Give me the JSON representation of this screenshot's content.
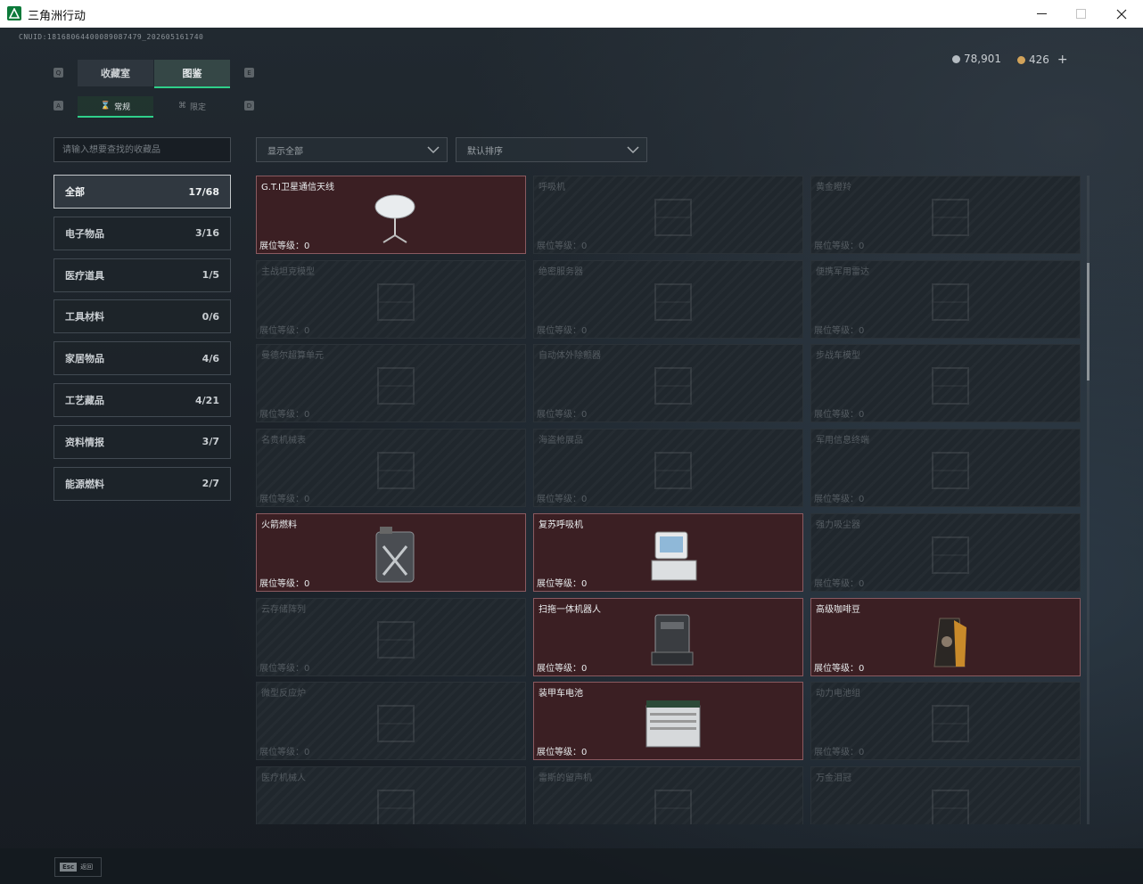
{
  "window": {
    "title": "三角洲行动"
  },
  "header": {
    "uid": "CNUID:1816806440008908747​9_202605161740",
    "currencies": [
      {
        "value": "78,901",
        "color": "#b5bcc2"
      },
      {
        "value": "426",
        "color": "#d2a35a"
      }
    ],
    "add_symbol": "+"
  },
  "tabs": [
    {
      "label": "收藏室",
      "active": false
    },
    {
      "label": "图鉴",
      "active": true
    }
  ],
  "subtabs": [
    {
      "label": "常规",
      "active": true
    },
    {
      "label": "限定",
      "active": false
    }
  ],
  "key_hints": {
    "tab_left": "Q",
    "tab_right": "E",
    "sub_left": "A",
    "sub_right": "D"
  },
  "search": {
    "placeholder": "请输入想要查找的收藏品"
  },
  "filters": {
    "display": "显示全部",
    "sort": "默认排序"
  },
  "categories": [
    {
      "label": "全部",
      "count": "17/68",
      "active": true
    },
    {
      "label": "电子物品",
      "count": "3/16",
      "active": false
    },
    {
      "label": "医疗道具",
      "count": "1/5",
      "active": false
    },
    {
      "label": "工具材料",
      "count": "0/6",
      "active": false
    },
    {
      "label": "家居物品",
      "count": "4/6",
      "active": false
    },
    {
      "label": "工艺藏品",
      "count": "4/21",
      "active": false
    },
    {
      "label": "资料情报",
      "count": "3/7",
      "active": false
    },
    {
      "label": "能源燃料",
      "count": "2/7",
      "active": false
    }
  ],
  "level_label": "展位等级：",
  "items": [
    {
      "name": "G.T.I卫星通信天线",
      "level": "0",
      "owned": true,
      "icon": "satellite-dish-icon"
    },
    {
      "name": "呼吸机",
      "level": "0",
      "owned": false,
      "icon": "ventilator-icon"
    },
    {
      "name": "黄金瞪羚",
      "level": "0",
      "owned": false,
      "icon": "gazelle-statue-icon"
    },
    {
      "name": "主战坦克模型",
      "level": "0",
      "owned": false,
      "icon": "tank-model-icon"
    },
    {
      "name": "绝密服务器",
      "level": "0",
      "owned": false,
      "icon": "server-icon"
    },
    {
      "name": "便携军用雷达",
      "level": "0",
      "owned": false,
      "icon": "radar-icon"
    },
    {
      "name": "曼德尔超算单元",
      "level": "0",
      "owned": false,
      "icon": "compute-unit-icon"
    },
    {
      "name": "自动体外除颤器",
      "level": "0",
      "owned": false,
      "icon": "defibrillator-icon"
    },
    {
      "name": "步战车模型",
      "level": "0",
      "owned": false,
      "icon": "ifv-model-icon"
    },
    {
      "name": "名贵机械表",
      "level": "0",
      "owned": false,
      "icon": "watch-icon"
    },
    {
      "name": "海盗枪展品",
      "level": "0",
      "owned": false,
      "icon": "rifle-icon"
    },
    {
      "name": "军用信息终端",
      "level": "0",
      "owned": false,
      "icon": "terminal-icon"
    },
    {
      "name": "火箭燃料",
      "level": "0",
      "owned": true,
      "icon": "fuel-canister-icon"
    },
    {
      "name": "复苏呼吸机",
      "level": "0",
      "owned": true,
      "icon": "resuscitator-icon"
    },
    {
      "name": "强力吸尘器",
      "level": "0",
      "owned": false,
      "icon": "vacuum-icon"
    },
    {
      "name": "云存储阵列",
      "level": "0",
      "owned": false,
      "icon": "storage-array-icon"
    },
    {
      "name": "扫拖一体机器人",
      "level": "0",
      "owned": true,
      "icon": "robot-vacuum-icon"
    },
    {
      "name": "高级咖啡豆",
      "level": "0",
      "owned": true,
      "icon": "coffee-bag-icon"
    },
    {
      "name": "微型反应炉",
      "level": "0",
      "owned": false,
      "icon": "reactor-icon"
    },
    {
      "name": "装甲车电池",
      "level": "0",
      "owned": true,
      "icon": "battery-icon"
    },
    {
      "name": "动力电池组",
      "level": "0",
      "owned": false,
      "icon": "battery-pack-icon"
    },
    {
      "name": "医疗机械人",
      "level": "",
      "owned": false,
      "icon": "medical-robot-icon"
    },
    {
      "name": "雷斯的留声机",
      "level": "",
      "owned": false,
      "icon": "gramophone-icon"
    },
    {
      "name": "万金泪冠",
      "level": "",
      "owned": false,
      "icon": "crown-icon"
    }
  ],
  "footer": {
    "esc_key": "Esc",
    "esc_label": "返回"
  }
}
